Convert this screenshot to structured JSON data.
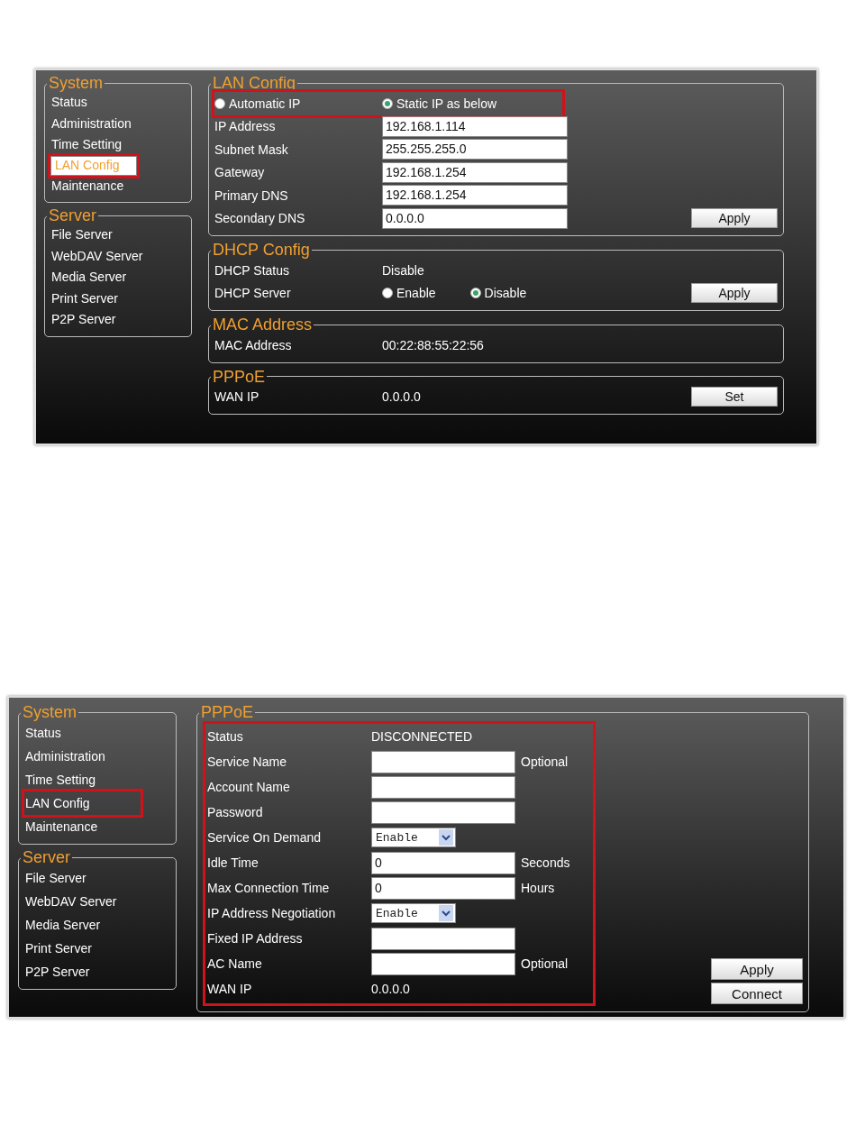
{
  "screenshots": [
    {
      "sidebar": [
        {
          "title": "System",
          "items": [
            {
              "label": "Status",
              "selected": false,
              "highlighted": false
            },
            {
              "label": "Administration",
              "selected": false,
              "highlighted": false
            },
            {
              "label": "Time Setting",
              "selected": false,
              "highlighted": false
            },
            {
              "label": "LAN Config",
              "selected": true,
              "highlighted": true
            },
            {
              "label": "Maintenance",
              "selected": false,
              "highlighted": false
            }
          ]
        },
        {
          "title": "Server",
          "items": [
            {
              "label": "File Server",
              "selected": false,
              "highlighted": false
            },
            {
              "label": "WebDAV Server",
              "selected": false,
              "highlighted": false
            },
            {
              "label": "Media Server",
              "selected": false,
              "highlighted": false
            },
            {
              "label": "Print Server",
              "selected": false,
              "highlighted": false
            },
            {
              "label": "P2P Server",
              "selected": false,
              "highlighted": false
            }
          ]
        }
      ],
      "panels": [
        {
          "title": "LAN Config",
          "highlighted": false,
          "rows": [
            {
              "kind": "radios",
              "highlighted": true,
              "options": [
                {
                  "label": "Automatic IP",
                  "selected": false
                },
                {
                  "label": "Static IP as below",
                  "selected": true
                }
              ]
            },
            {
              "kind": "input",
              "label": "IP Address",
              "value": "192.168.1.114"
            },
            {
              "kind": "input",
              "label": "Subnet Mask",
              "value": "255.255.255.0"
            },
            {
              "kind": "input",
              "label": "Gateway",
              "value": "192.168.1.254"
            },
            {
              "kind": "input",
              "label": "Primary DNS",
              "value": "192.168.1.254"
            },
            {
              "kind": "input",
              "label": "Secondary DNS",
              "value": "0.0.0.0"
            }
          ],
          "buttons": [
            "Apply"
          ]
        },
        {
          "title": "DHCP Config",
          "highlighted": false,
          "rows": [
            {
              "kind": "text",
              "label": "DHCP Status",
              "value": "Disable"
            },
            {
              "kind": "radios",
              "label": "DHCP Server",
              "highlighted": false,
              "options": [
                {
                  "label": "Enable",
                  "selected": false
                },
                {
                  "label": "Disable",
                  "selected": true
                }
              ]
            }
          ],
          "buttons": [
            "Apply"
          ]
        },
        {
          "title": "MAC Address",
          "highlighted": false,
          "rows": [
            {
              "kind": "text",
              "label": "MAC Address",
              "value": "00:22:88:55:22:56"
            }
          ]
        },
        {
          "title": "PPPoE",
          "highlighted": false,
          "rows": [
            {
              "kind": "text",
              "label": "WAN IP",
              "value": "0.0.0.0"
            }
          ],
          "buttons": [
            "Set"
          ]
        }
      ]
    },
    {
      "sidebar": [
        {
          "title": "System",
          "items": [
            {
              "label": "Status",
              "selected": false,
              "highlighted": false
            },
            {
              "label": "Administration",
              "selected": false,
              "highlighted": false
            },
            {
              "label": "Time Setting",
              "selected": false,
              "highlighted": false
            },
            {
              "label": "LAN Config",
              "selected": false,
              "highlighted": true
            },
            {
              "label": "Maintenance",
              "selected": false,
              "highlighted": false
            }
          ]
        },
        {
          "title": "Server",
          "items": [
            {
              "label": "File Server",
              "selected": false,
              "highlighted": false
            },
            {
              "label": "WebDAV Server",
              "selected": false,
              "highlighted": false
            },
            {
              "label": "Media Server",
              "selected": false,
              "highlighted": false
            },
            {
              "label": "Print Server",
              "selected": false,
              "highlighted": false
            },
            {
              "label": "P2P Server",
              "selected": false,
              "highlighted": false
            }
          ]
        }
      ],
      "panels": [
        {
          "title": "PPPoE",
          "highlighted": true,
          "rows": [
            {
              "kind": "text",
              "label": "Status",
              "value": "DISCONNECTED"
            },
            {
              "kind": "input",
              "label": "Service Name",
              "suffix": "Optional"
            },
            {
              "kind": "input",
              "label": "Account Name"
            },
            {
              "kind": "input",
              "label": "Password"
            },
            {
              "kind": "select",
              "label": "Service On Demand",
              "value": "Enable"
            },
            {
              "kind": "input",
              "label": "Idle Time",
              "value": "0",
              "suffix": "Seconds"
            },
            {
              "kind": "input",
              "label": "Max Connection Time",
              "value": "0",
              "suffix": "Hours"
            },
            {
              "kind": "select",
              "label": "IP Address Negotiation",
              "value": "Enable"
            },
            {
              "kind": "input",
              "label": "Fixed IP Address"
            },
            {
              "kind": "input",
              "label": "AC Name",
              "suffix": "Optional"
            },
            {
              "kind": "text",
              "label": "WAN IP",
              "value": "0.0.0.0"
            }
          ],
          "buttons": [
            "Apply",
            "Connect"
          ]
        }
      ]
    }
  ]
}
